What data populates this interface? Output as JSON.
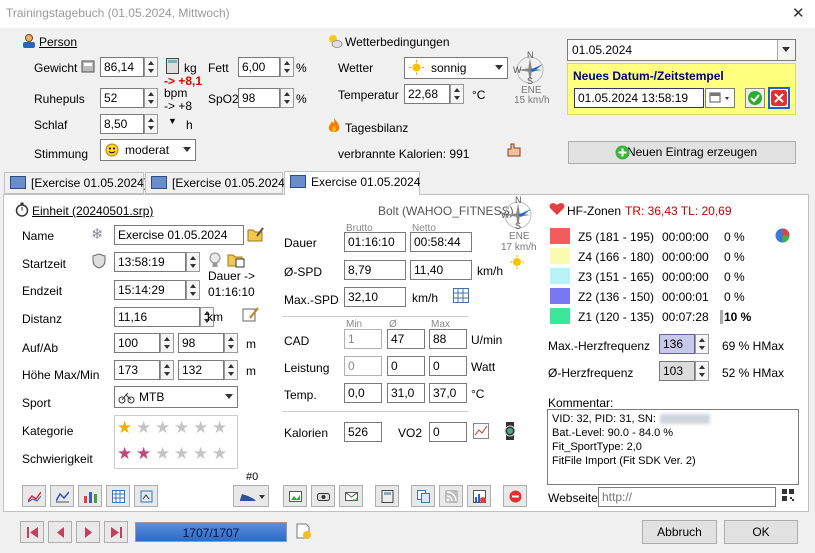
{
  "window": {
    "title": "Trainingstagebuch (01.05.2024, Mittwoch)"
  },
  "person": {
    "header": "Person",
    "gewicht_label": "Gewicht",
    "gewicht": "86,14",
    "kg": "kg",
    "gewicht_delta": "-> +8,1",
    "fett_label": "Fett",
    "fett": "6,00",
    "percent": "%",
    "ruhepuls_label": "Ruhepuls",
    "ruhepuls": "52",
    "bpm": "bpm",
    "ruhepuls_delta": "-> +8",
    "spo2_label": "SpO2",
    "spo2": "98",
    "schlaf_label": "Schlaf",
    "schlaf": "8,50",
    "h": "h",
    "stimmung_label": "Stimmung",
    "stimmung": "moderat"
  },
  "wetter": {
    "header": "Wetterbedingungen",
    "wetter_label": "Wetter",
    "wetter": "sonnig",
    "temp_label": "Temperatur",
    "temp": "22,68",
    "celsius": "°C",
    "wind_dir": "ENE",
    "wind_speed": "15 km/h",
    "compass": {
      "n": "N",
      "w": "W",
      "e": "E",
      "s": "S"
    }
  },
  "tagesbilanz": {
    "header": "Tagesbilanz",
    "kalorien": "verbrannte Kalorien: 991"
  },
  "datum": {
    "selected": "01.05.2024",
    "new_header": "Neues Datum-/Zeitstempel",
    "new_value": "01.05.2024 13:58:19",
    "new_entry_button": "Neuen Eintrag erzeugen"
  },
  "tabs": [
    "[Exercise 01.05.2024]",
    "[Exercise 01.05.2024]",
    "Exercise 01.05.2024"
  ],
  "einheit": {
    "header": "Einheit (20240501.srp)",
    "device": "Bolt (WAHOO_FITNESS)",
    "wind_dir": "ENE",
    "wind_speed": "17 km/h",
    "name_label": "Name",
    "name": "Exercise 01.05.2024",
    "startzeit_label": "Startzeit",
    "startzeit": "13:58:19",
    "dauer_note1": "Dauer ->",
    "dauer_note2": "01:16:10",
    "endzeit_label": "Endzeit",
    "endzeit": "15:14:29",
    "distanz_label": "Distanz",
    "distanz": "11,16",
    "km": "km",
    "aufab_label": "Auf/Ab",
    "auf": "100",
    "ab": "98",
    "m": "m",
    "hoehe_label": "Höhe Max/Min",
    "hoehe_max": "173",
    "hoehe_min": "132",
    "sport_label": "Sport",
    "sport": "MTB",
    "kategorie_label": "Kategorie",
    "schwierigkeit_label": "Schwierigkeit",
    "kategorie_rating": 1,
    "schwierigkeit_rating": 2,
    "stars_max": 6,
    "counter": "#0"
  },
  "werte": {
    "brutto": "Brutto",
    "netto": "Netto",
    "dauer_label": "Dauer",
    "dauer_brutto": "01:16:10",
    "dauer_netto": "00:58:44",
    "spd_label": "Ø-SPD",
    "spd_brutto": "8,79",
    "spd_netto": "11,40",
    "kmh": "km/h",
    "maxspd_label": "Max.-SPD",
    "maxspd": "32,10",
    "min": "Min",
    "avg": "Ø",
    "max": "Max",
    "cad_label": "CAD",
    "cad_min": "1",
    "cad_avg": "47",
    "cad_max": "88",
    "umin": "U/min",
    "leistung_label": "Leistung",
    "leistung_min": "0",
    "leistung_avg": "0",
    "leistung_max": "0",
    "watt": "Watt",
    "temp_label": "Temp.",
    "temp_min": "0,0",
    "temp_avg": "31,0",
    "temp_max": "37,0",
    "celsius": "°C",
    "kalorien_label": "Kalorien",
    "kalorien": "526",
    "vo2_label": "VO2",
    "vo2": "0"
  },
  "hf": {
    "header": "HF-Zonen",
    "tr_tl": "TR: 36,43  TL: 20,69",
    "zones": [
      {
        "label": "Z5 (181 - 195)",
        "time": "00:00:00",
        "pct": "0 %",
        "color": "#f25c5c",
        "bold": false
      },
      {
        "label": "Z4 (166 - 180)",
        "time": "00:00:00",
        "pct": "0 %",
        "color": "#fafab0",
        "bold": false
      },
      {
        "label": "Z3 (151 - 165)",
        "time": "00:00:00",
        "pct": "0 %",
        "color": "#b6f2f6",
        "bold": false
      },
      {
        "label": "Z2 (136 - 150)",
        "time": "00:00:01",
        "pct": "0 %",
        "color": "#7878f0",
        "bold": false
      },
      {
        "label": "Z1 (120 - 135)",
        "time": "00:07:28",
        "pct": "10 %",
        "color": "#3ce69a",
        "bold": true
      }
    ],
    "maxhf_label": "Max.-Herzfrequenz",
    "maxhf": "136",
    "maxhf_pct": "69 % HMax",
    "avghf_label": "Ø-Herzfrequenz",
    "avghf": "103",
    "avghf_pct": "52 % HMax"
  },
  "kommentar": {
    "header": "Kommentar:",
    "lines": [
      "VID: 32, PID: 31, SN:",
      "Bat.-Level: 90.0 - 84.0 %",
      "Fit_SportType: 2,0",
      "FitFile Import (Fit SDK Ver. 2)"
    ],
    "webseite_label": "Webseite:",
    "webseite_placeholder": "http://"
  },
  "footer": {
    "progress": "1707/1707",
    "progress_fraction": 1.0,
    "cancel": "Abbruch",
    "ok": "OK"
  },
  "colors": {
    "accent_yellow": "#ffff80",
    "header_blue": "#000080",
    "red": "#e00000",
    "hf_red": "#c00000",
    "progress": "#2d6bc5"
  }
}
